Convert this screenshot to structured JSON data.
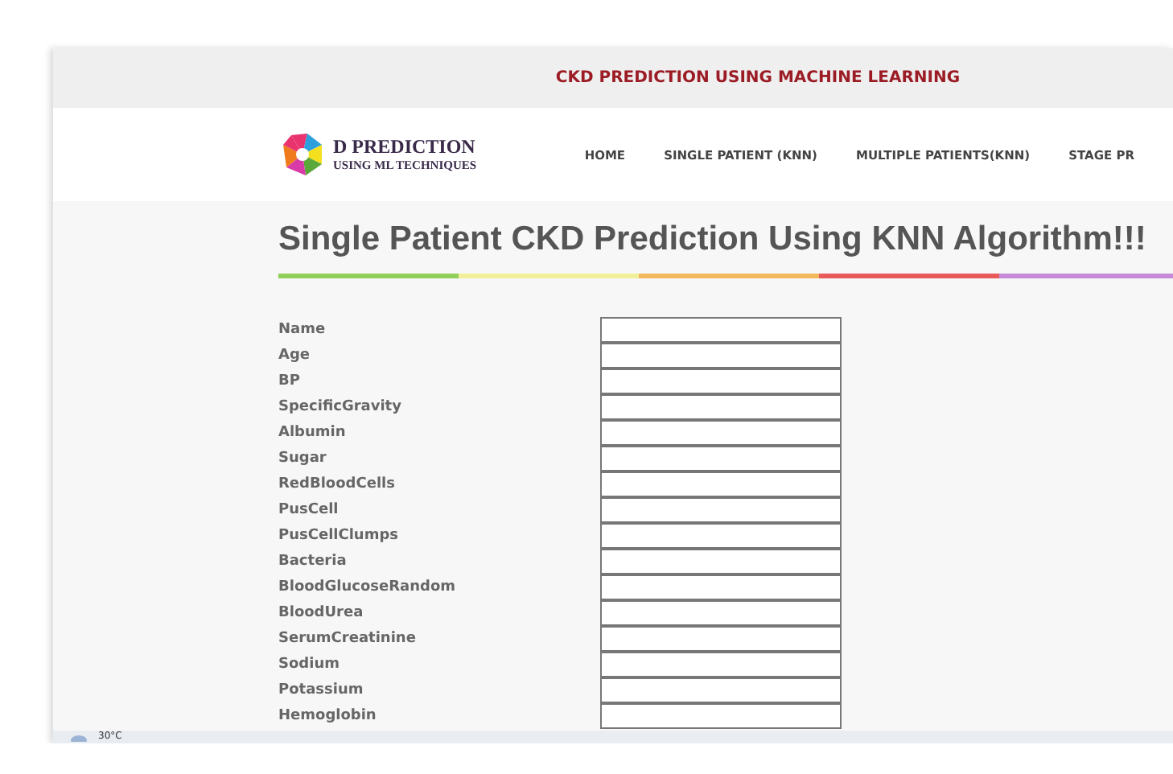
{
  "top_bar": {
    "title": "CKD PREDICTION USING MACHINE LEARNING"
  },
  "logo": {
    "title": "D PREDICTION",
    "subtitle": "USING ML TECHNIQUES"
  },
  "nav": [
    {
      "label": "HOME"
    },
    {
      "label": "SINGLE PATIENT (KNN)"
    },
    {
      "label": "MULTIPLE PATIENTS(KNN)"
    },
    {
      "label": "STAGE PR"
    }
  ],
  "heading": "Single Patient CKD Prediction Using KNN Algorithm!!!",
  "fields": [
    {
      "label": "Name"
    },
    {
      "label": "Age"
    },
    {
      "label": "BP"
    },
    {
      "label": "SpecificGravity"
    },
    {
      "label": "Albumin"
    },
    {
      "label": "Sugar"
    },
    {
      "label": "RedBloodCells"
    },
    {
      "label": "PusCell"
    },
    {
      "label": "PusCellClumps"
    },
    {
      "label": "Bacteria"
    },
    {
      "label": "BloodGlucoseRandom"
    },
    {
      "label": "BloodUrea"
    },
    {
      "label": "SerumCreatinine"
    },
    {
      "label": "Sodium"
    },
    {
      "label": "Potassium"
    },
    {
      "label": "Hemoglobin"
    }
  ],
  "taskbar": {
    "weather": "30°C"
  }
}
